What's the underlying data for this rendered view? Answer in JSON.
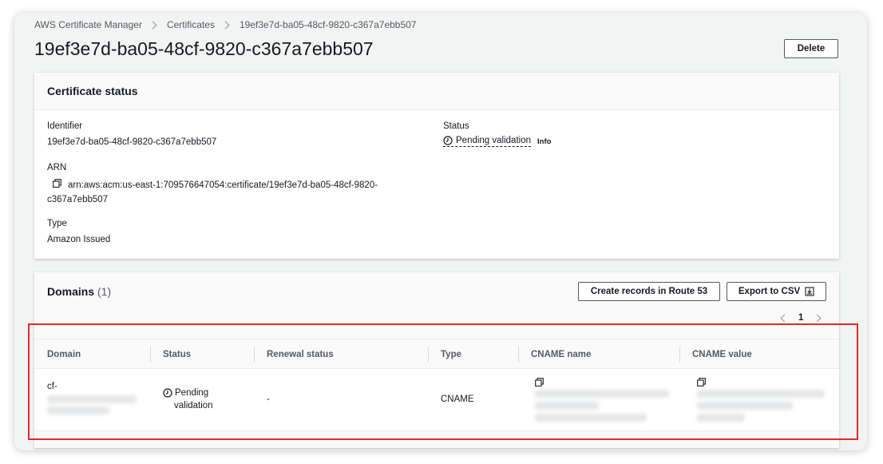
{
  "breadcrumb": {
    "items": [
      "AWS Certificate Manager",
      "Certificates",
      "19ef3e7d-ba05-48cf-9820-c367a7ebb507"
    ]
  },
  "page": {
    "title": "19ef3e7d-ba05-48cf-9820-c367a7ebb507",
    "delete_label": "Delete"
  },
  "certificate_status": {
    "heading": "Certificate status",
    "identifier_label": "Identifier",
    "identifier_value": "19ef3e7d-ba05-48cf-9820-c367a7ebb507",
    "arn_label": "ARN",
    "arn_value_line1": "arn:aws:acm:us-east-1:709576647054:certificate/19ef3e7d-ba05-48cf-9820-",
    "arn_value_line2": "c367a7ebb507",
    "type_label": "Type",
    "type_value": "Amazon Issued",
    "status_label": "Status",
    "status_value": "Pending validation",
    "info_label": "Info"
  },
  "domains": {
    "heading": "Domains",
    "count": "(1)",
    "create_records_label": "Create records in Route 53",
    "export_label": "Export to CSV",
    "page_number": "1",
    "columns": [
      "Domain",
      "Status",
      "Renewal status",
      "Type",
      "CNAME name",
      "CNAME value"
    ],
    "row": {
      "domain_prefix": "cf-",
      "status_line1": "Pending",
      "status_line2": "validation",
      "renewal": "-",
      "type": "CNAME"
    }
  },
  "colors": {
    "highlight": "#e02b2b",
    "text": "#16191f",
    "muted": "#545b64"
  }
}
